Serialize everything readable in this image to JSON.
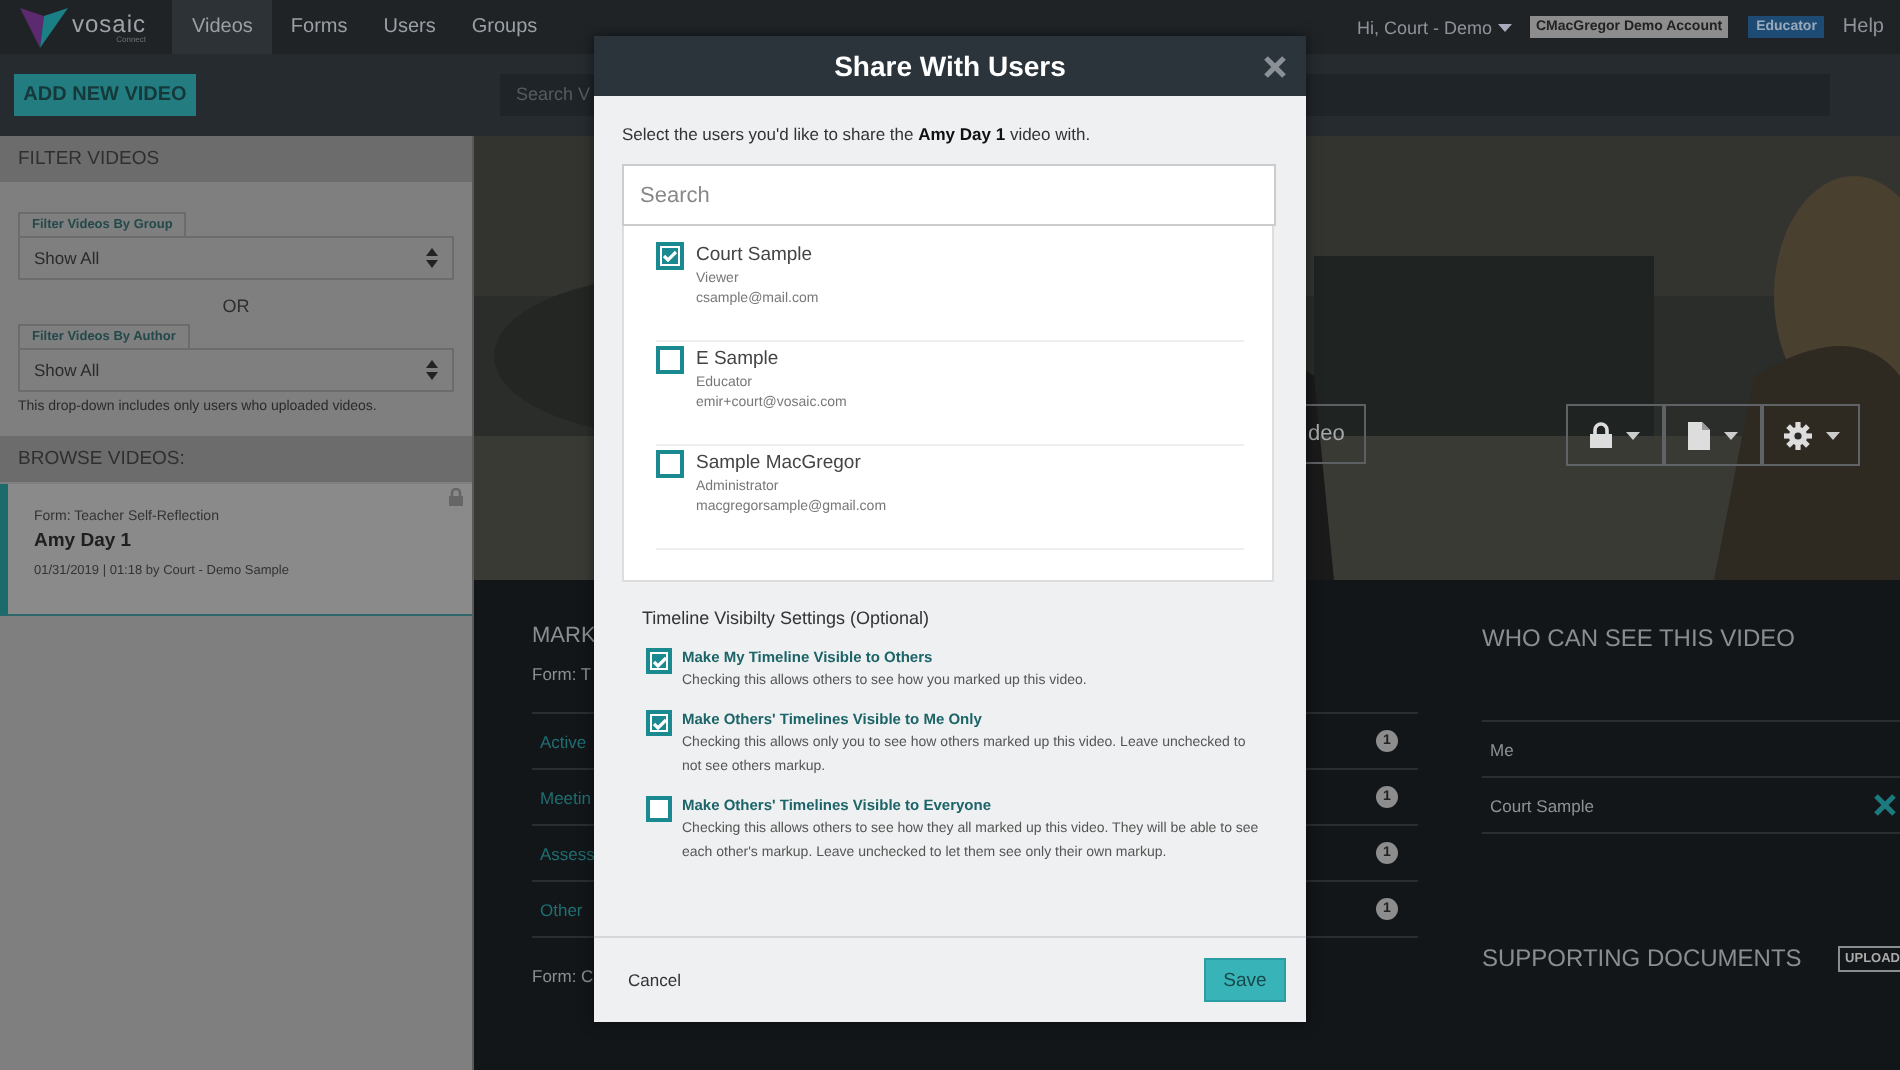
{
  "nav": {
    "logo_text": "vosaic",
    "logo_subtext": "Connect",
    "items": [
      {
        "label": "Videos",
        "selected": true
      },
      {
        "label": "Forms",
        "selected": false
      },
      {
        "label": "Users",
        "selected": false
      },
      {
        "label": "Groups",
        "selected": false
      }
    ],
    "user_menu": "Hi, Court - Demo",
    "account_badge": "CMacGregor Demo Account",
    "role_badge": "Educator",
    "help": "Help"
  },
  "toolbar": {
    "add_button": "ADD NEW VIDEO",
    "search_placeholder": "Search V"
  },
  "sidebar": {
    "filter_title": "FILTER VIDEOS",
    "filters": [
      {
        "label": "Filter Videos By Group",
        "value": "Show All"
      },
      {
        "label": "Filter Videos By Author",
        "value": "Show All"
      }
    ],
    "or": "OR",
    "note": "This drop-down includes only users who uploaded videos.",
    "browse_title": "BROWSE VIDEOS:",
    "videos": [
      {
        "form": "Form: Teacher Self-Reflection",
        "title": "Amy Day 1",
        "meta": "01/31/2019 | 01:18 by Court - Demo Sample",
        "selected": true
      }
    ]
  },
  "video": {
    "kind": "picture",
    "action_button": "deo"
  },
  "markup": {
    "title": "MARK",
    "form_1": "Form: T",
    "rows": [
      {
        "label": "Active",
        "count": "1"
      },
      {
        "label": "Meetin",
        "count": "1"
      },
      {
        "label": "Assess",
        "count": "1"
      },
      {
        "label": "Other",
        "count": "1"
      }
    ],
    "form_2": "Form: C"
  },
  "viewers": {
    "title": "WHO CAN SEE THIS VIDEO",
    "rows": [
      {
        "name": "Me",
        "removable": false
      },
      {
        "name": "Court Sample",
        "removable": true
      }
    ]
  },
  "documents": {
    "title": "SUPPORTING DOCUMENTS",
    "upload": "UPLOAD"
  },
  "modal": {
    "title": "Share With Users",
    "intro": "Select the users you'd like to share the **Amy Day 1** video with.",
    "search_placeholder": "Search",
    "users": [
      {
        "name": "Court Sample",
        "role": "Viewer",
        "email": "csample@mail.com",
        "checked": true
      },
      {
        "name": "E Sample",
        "role": "Educator",
        "email": "emir+court@vosaic.com",
        "checked": false
      },
      {
        "name": "Sample MacGregor",
        "role": "Administrator",
        "email": "macgregorsample@gmail.com",
        "checked": false
      }
    ],
    "settings_title": "Timeline Visibilty Settings (Optional)",
    "settings": [
      {
        "label": "Make My Timeline Visible to Others",
        "description": "Checking this allows others to see how you marked up this video.",
        "checked": true
      },
      {
        "label": "Make Others' Timelines Visible to Me Only",
        "description": "Checking this allows only you to see how others marked up this video. Leave unchecked to not see others markup.",
        "checked": true
      },
      {
        "label": "Make Others' Timelines Visible to Everyone",
        "description": "Checking this allows others to see how they all marked up this video. They will be able to see each other's markup. Leave unchecked to let them see only their own markup.",
        "checked": false
      }
    ],
    "cancel": "Cancel",
    "save": "Save"
  }
}
